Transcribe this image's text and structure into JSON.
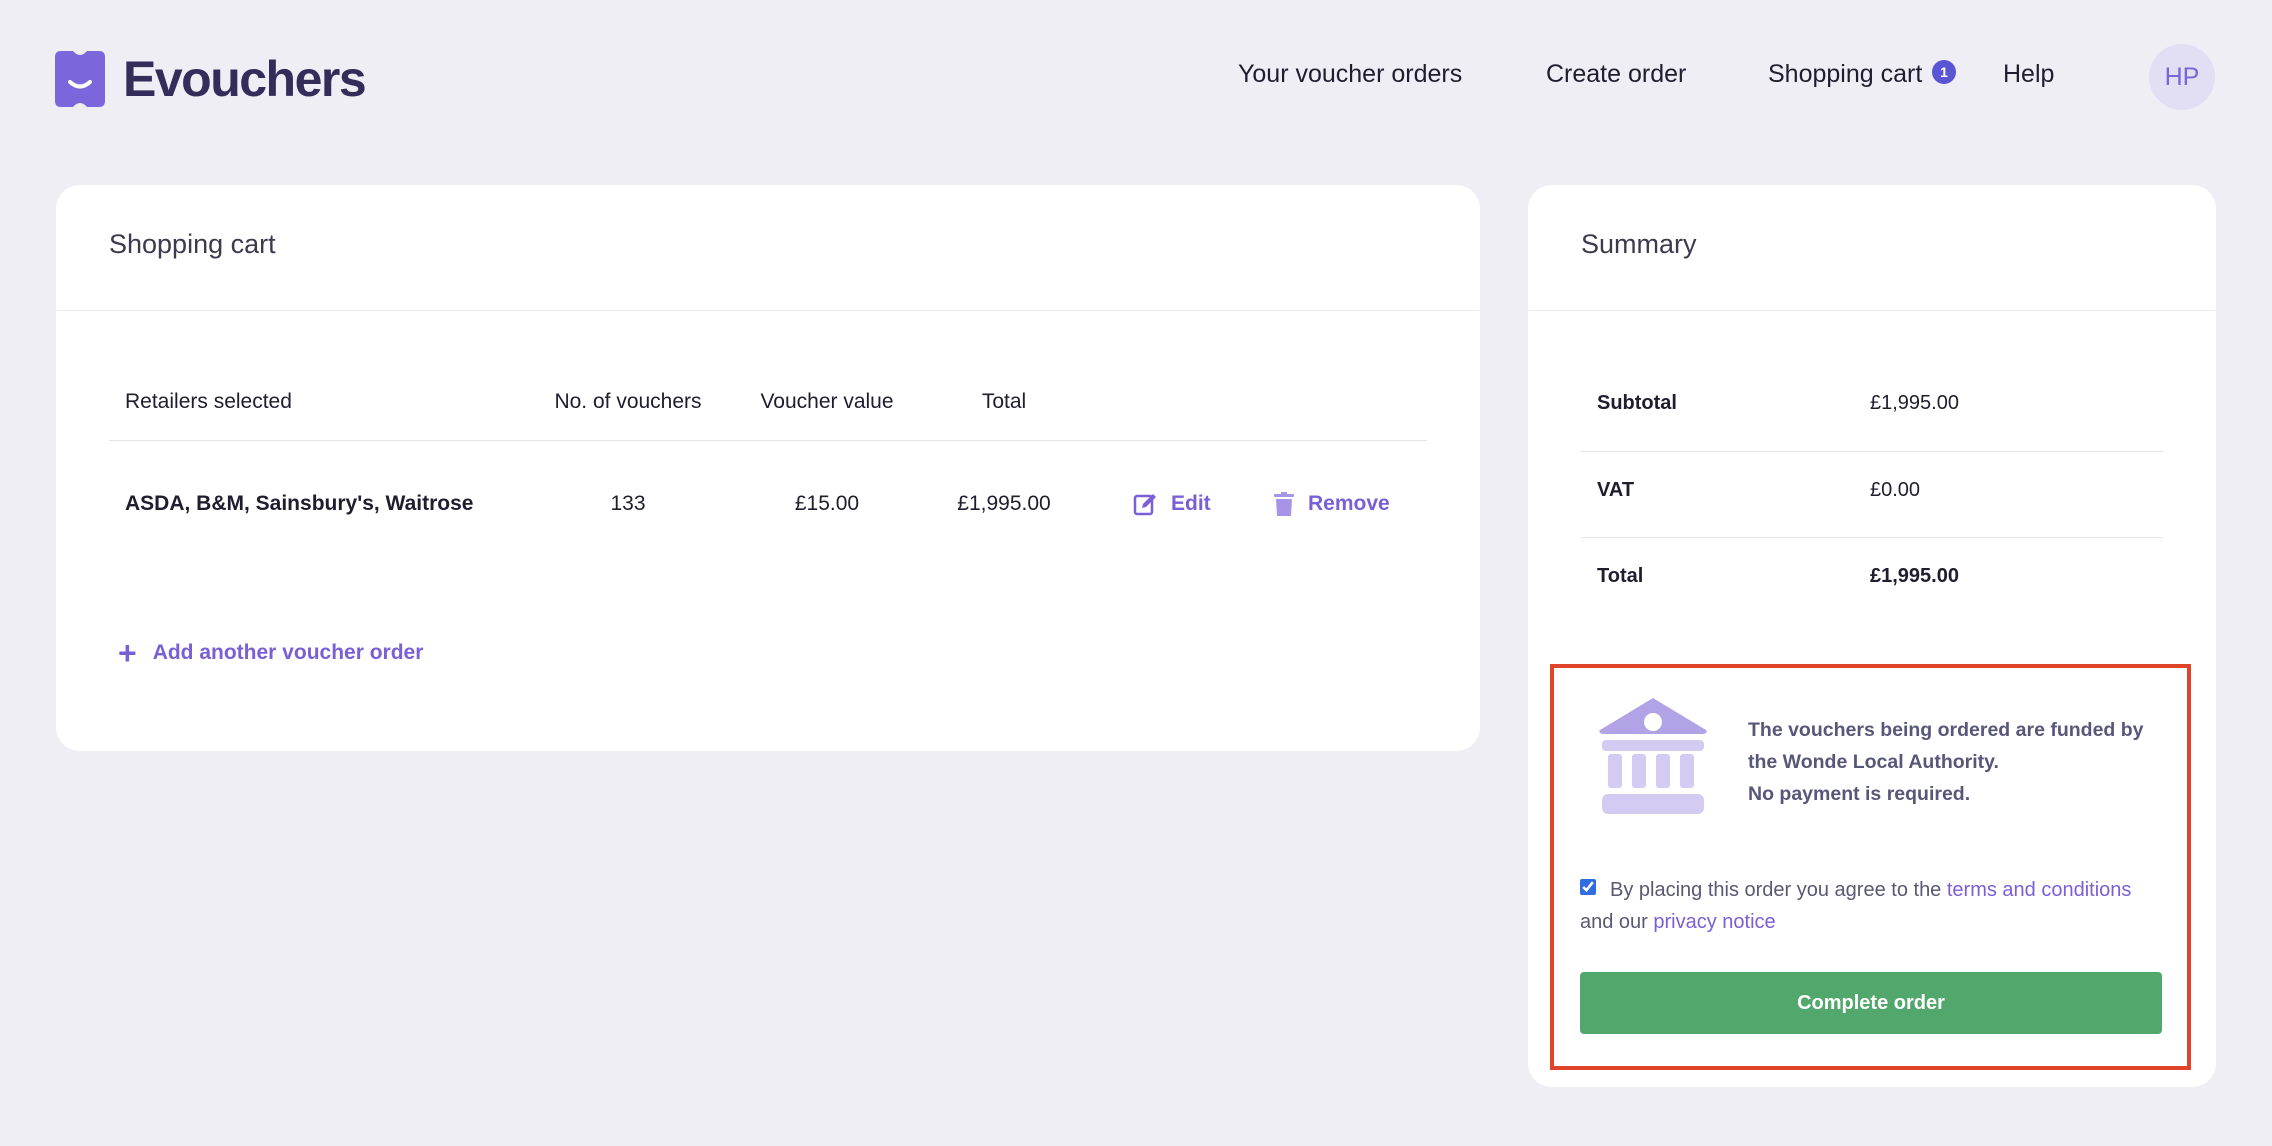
{
  "brand": {
    "name": "Evouchers",
    "accent": "#7a5fd6",
    "logo_color": "#7b66db"
  },
  "nav": {
    "orders": "Your voucher orders",
    "create": "Create order",
    "cart": "Shopping cart",
    "cart_count": "1",
    "help": "Help",
    "avatar_initials": "HP"
  },
  "cart": {
    "title": "Shopping cart",
    "columns": {
      "retailers": "Retailers selected",
      "count": "No. of vouchers",
      "value": "Voucher value",
      "total": "Total"
    },
    "rows": [
      {
        "retailers": "ASDA, B&M, Sainsbury's, Waitrose",
        "count": "133",
        "value": "£15.00",
        "total": "£1,995.00",
        "edit_label": "Edit",
        "remove_label": "Remove"
      }
    ],
    "add_label": "Add another voucher order",
    "icons": {
      "edit": "edit-icon",
      "remove": "trash-icon",
      "add": "plus-icon"
    }
  },
  "summary": {
    "title": "Summary",
    "subtotal_label": "Subtotal",
    "subtotal_value": "£1,995.00",
    "vat_label": "VAT",
    "vat_value": "£0.00",
    "total_label": "Total",
    "total_value": "£1,995.00",
    "funding_line1": "The vouchers being ordered are funded by the Wonde Local Authority.",
    "funding_line2": "No payment is required.",
    "funding_icon": "bank-icon",
    "terms_checked": true,
    "terms_prefix": "By placing this order you agree to the ",
    "terms_link": "terms and conditions",
    "terms_middle": " and our ",
    "privacy_link": "privacy notice",
    "complete_label": "Complete order",
    "complete_color": "#52a86c",
    "highlight_color": "#e0452c"
  }
}
